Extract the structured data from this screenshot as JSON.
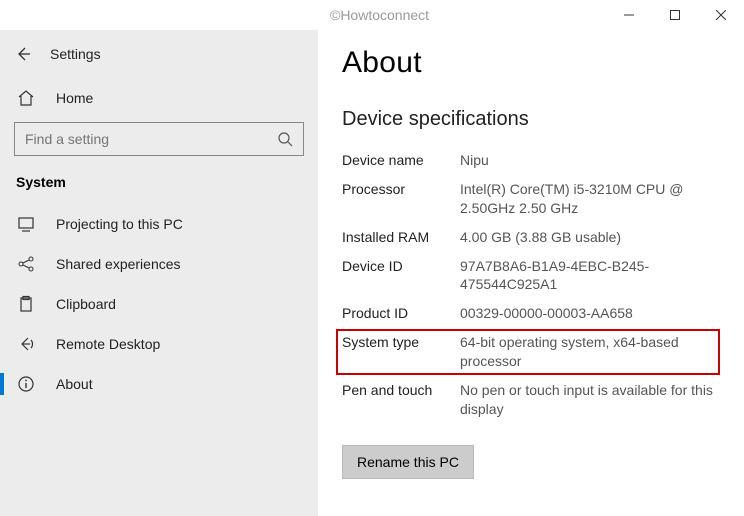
{
  "watermark": "©Howtoconnect",
  "window": {
    "app_title": "Settings"
  },
  "sidebar": {
    "home_label": "Home",
    "search_placeholder": "Find a setting",
    "section_label": "System",
    "items": [
      {
        "label": "Projecting to this PC"
      },
      {
        "label": "Shared experiences"
      },
      {
        "label": "Clipboard"
      },
      {
        "label": "Remote Desktop"
      },
      {
        "label": "About"
      }
    ]
  },
  "content": {
    "heading": "About",
    "section_heading": "Device specifications",
    "specs": {
      "device_name_label": "Device name",
      "device_name_value": "Nipu",
      "processor_label": "Processor",
      "processor_value": "Intel(R) Core(TM) i5-3210M CPU @ 2.50GHz   2.50 GHz",
      "ram_label": "Installed RAM",
      "ram_value": "4.00 GB (3.88 GB usable)",
      "device_id_label": "Device ID",
      "device_id_value": "97A7B8A6-B1A9-4EBC-B245-475544C925A1",
      "product_id_label": "Product ID",
      "product_id_value": "00329-00000-00003-AA658",
      "system_type_label": "System type",
      "system_type_value": "64-bit operating system, x64-based processor",
      "pen_touch_label": "Pen and touch",
      "pen_touch_value": "No pen or touch input is available for this display"
    },
    "rename_button": "Rename this PC"
  }
}
